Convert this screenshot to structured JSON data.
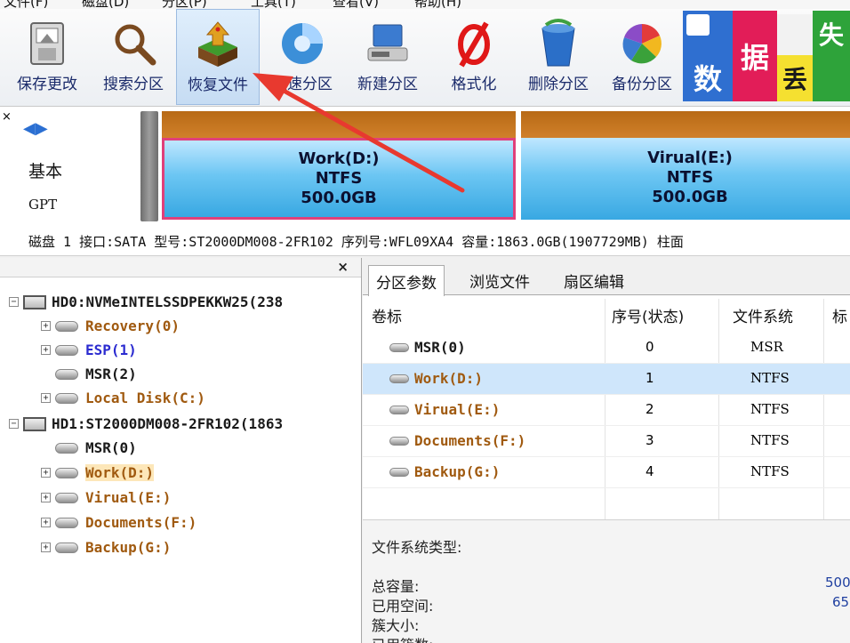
{
  "menubar": {
    "items": [
      "文件(F)",
      "磁盘(D)",
      "分区(P)",
      "工具(T)",
      "查看(V)",
      "帮助(H)"
    ]
  },
  "toolbar": {
    "save": "保存更改",
    "search": "搜索分区",
    "restore": "恢复文件",
    "quick": "快速分区",
    "new": "新建分区",
    "format": "格式化",
    "delete": "删除分区",
    "backup": "备份分区"
  },
  "tiles": {
    "shu": "数",
    "ju": "据",
    "diu": "丢",
    "shi": "失"
  },
  "diskmap": {
    "type": "基本",
    "scheme": "GPT",
    "partitions": [
      {
        "name": "Work(D:)",
        "fs": "NTFS",
        "size": "500.0GB"
      },
      {
        "name": "Virual(E:)",
        "fs": "NTFS",
        "size": "500.0GB"
      }
    ],
    "detail": "磁盘 1 接口:SATA  型号:ST2000DM008-2FR102  序列号:WFL09XA4  容量:1863.0GB(1907729MB)  柱面"
  },
  "tree": {
    "close": "×",
    "hd0": "HD0:NVMeINTELSSDPEKKW25(238",
    "hd0_children": [
      "Recovery(0)",
      "ESP(1)",
      "MSR(2)",
      "Local Disk(C:)"
    ],
    "hd1": "HD1:ST2000DM008-2FR102(1863",
    "hd1_children": [
      "MSR(0)",
      "Work(D:)",
      "Virual(E:)",
      "Documents(F:)",
      "Backup(G:)"
    ]
  },
  "tabs": {
    "params": "分区参数",
    "browse": "浏览文件",
    "sector": "扇区编辑"
  },
  "table": {
    "headers": {
      "label": "卷标",
      "index": "序号(状态)",
      "fs": "文件系统",
      "more": "标"
    },
    "rows": [
      {
        "name": "MSR(0)",
        "index": "0",
        "fs": "MSR"
      },
      {
        "name": "Work(D:)",
        "index": "1",
        "fs": "NTFS"
      },
      {
        "name": "Virual(E:)",
        "index": "2",
        "fs": "NTFS"
      },
      {
        "name": "Documents(F:)",
        "index": "3",
        "fs": "NTFS"
      },
      {
        "name": "Backup(G:)",
        "index": "4",
        "fs": "NTFS"
      }
    ]
  },
  "details": {
    "fs_type": "文件系统类型:",
    "total": "总容量:",
    "total_val": "500",
    "used": "已用空间:",
    "used_val": "65",
    "cluster": "簇大小:",
    "used_clusters": "已用簇数:"
  }
}
